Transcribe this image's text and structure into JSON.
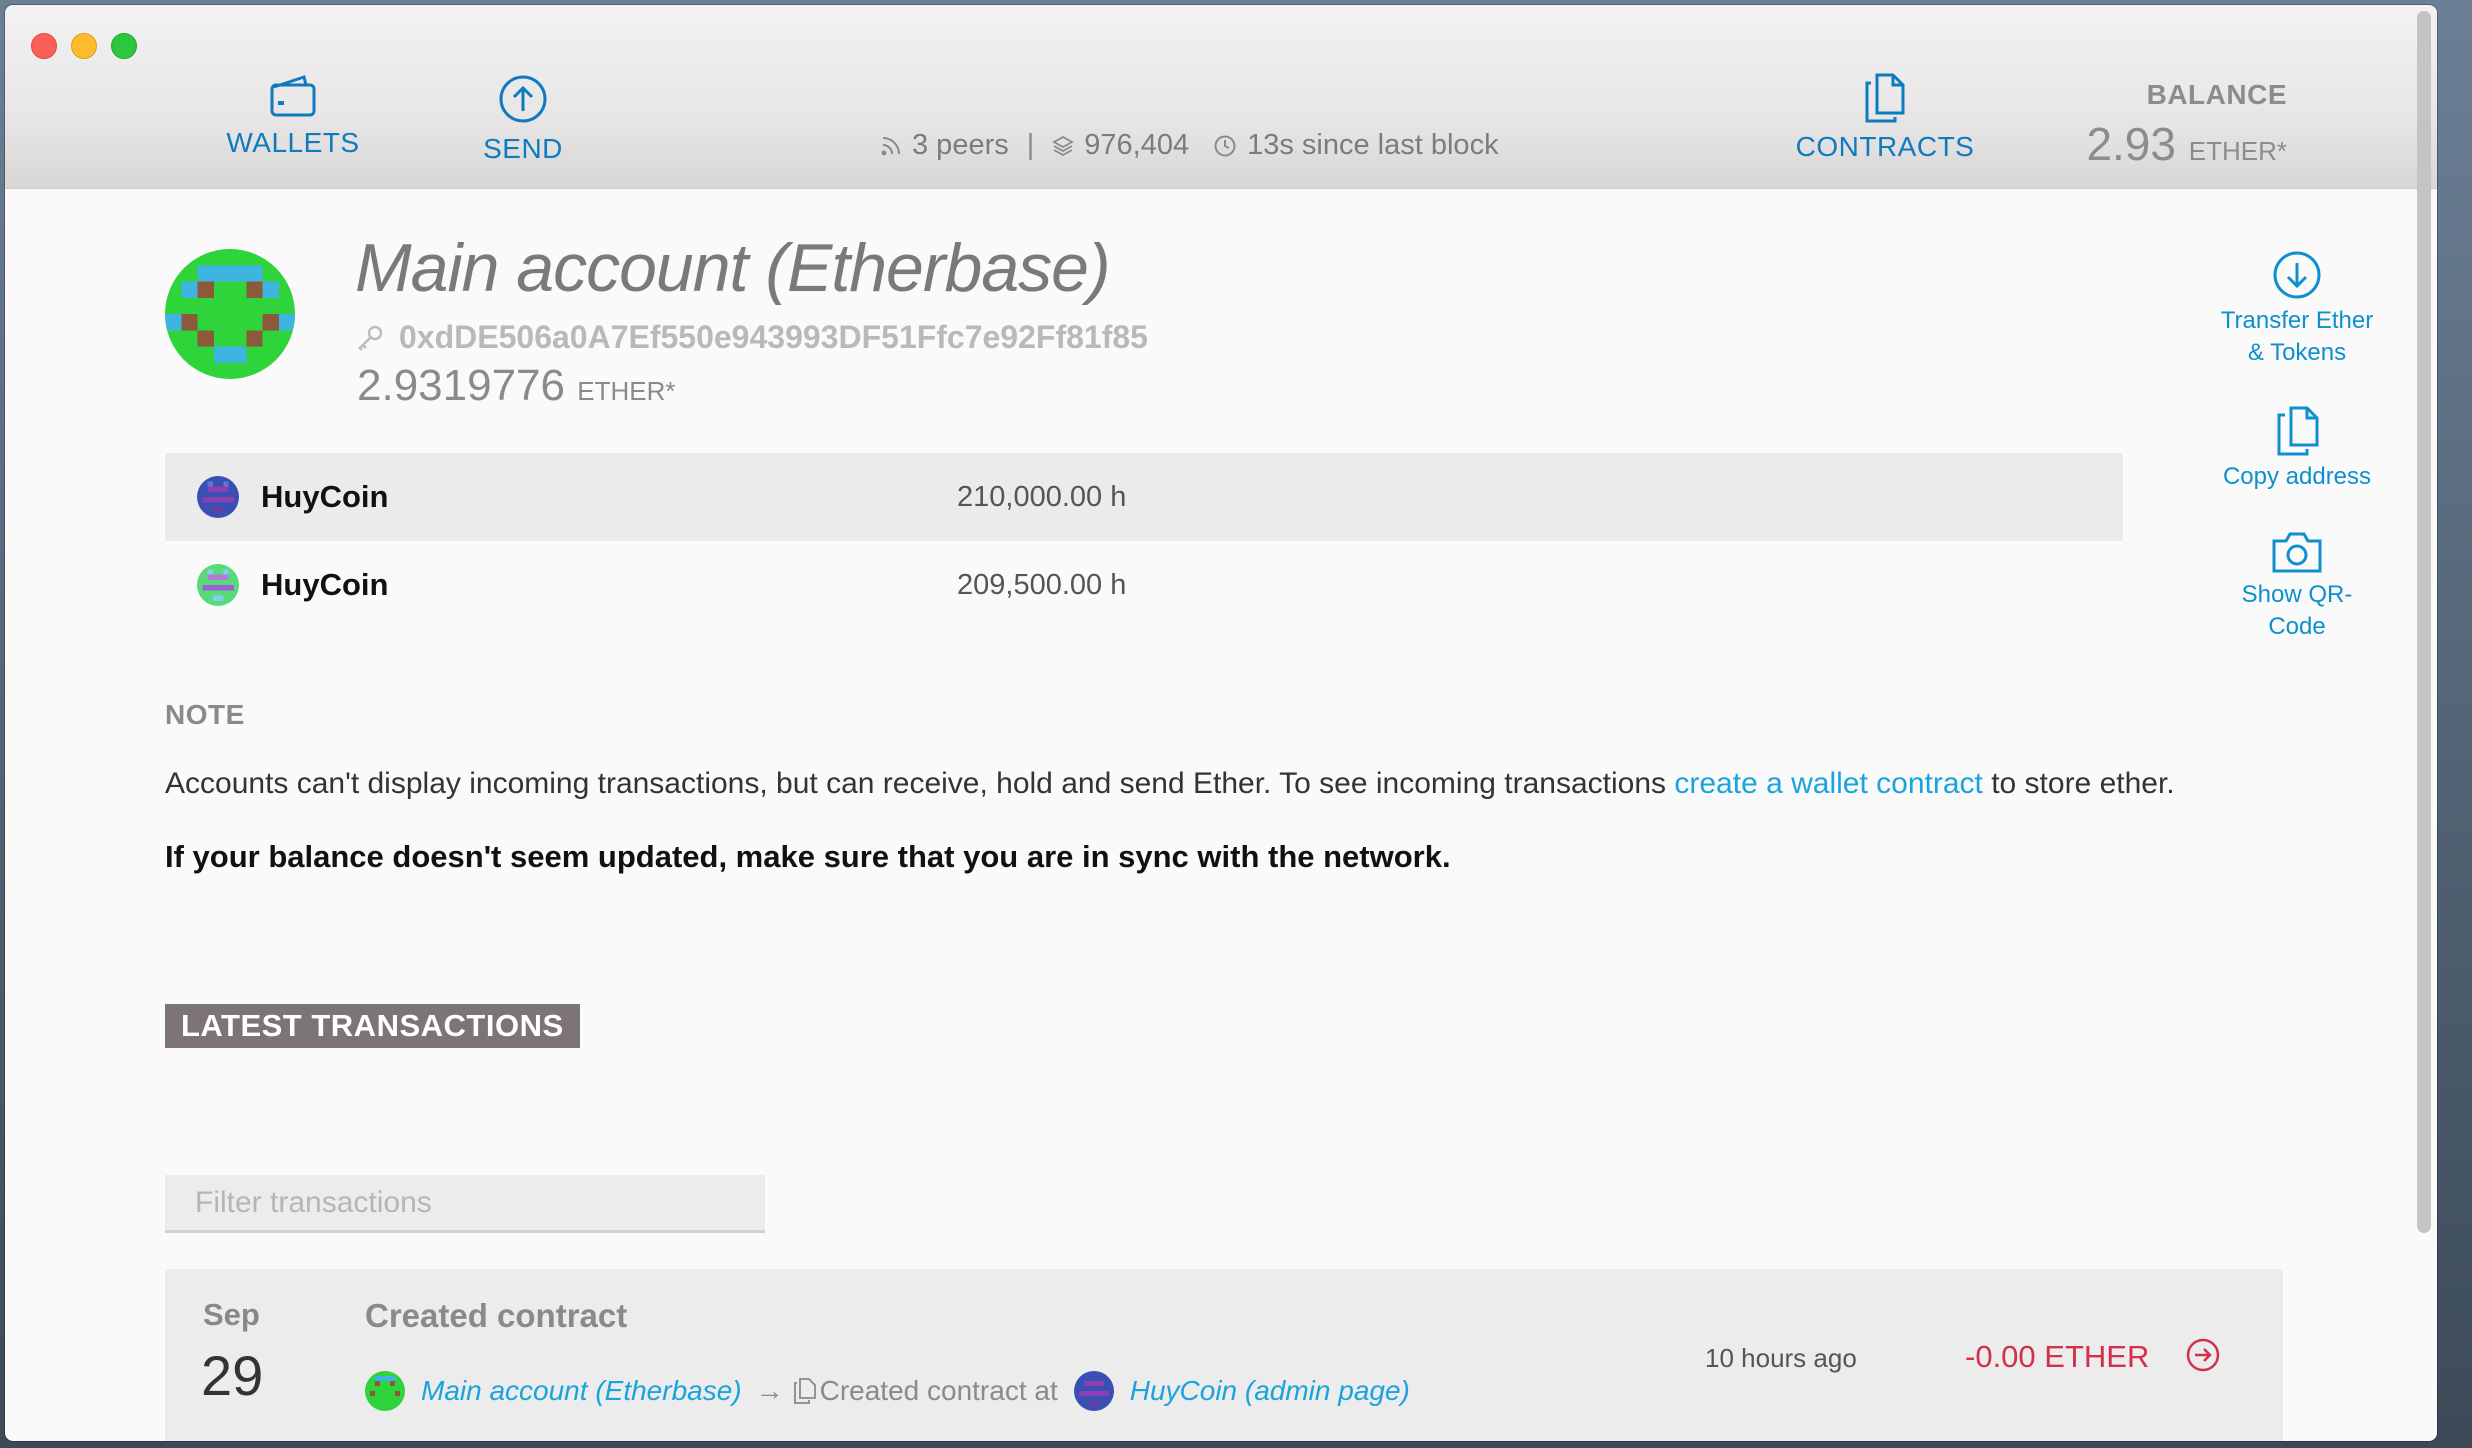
{
  "nav": {
    "wallets": "WALLETS",
    "send": "SEND",
    "contracts": "CONTRACTS"
  },
  "status": {
    "peers": "3 peers",
    "block": "976,404",
    "since": "13s since last block"
  },
  "balance": {
    "label": "BALANCE",
    "value": "2.93",
    "unit": "ETHER*"
  },
  "account": {
    "name": "Main account (Etherbase)",
    "address": "0xdDE506a0A7Ef550e943993DF51Ffc7e92Ff81f85",
    "balance": "2.9319776",
    "unit": "ETHER*"
  },
  "tokens": [
    {
      "name": "HuyCoin",
      "value": "210,000.00 h"
    },
    {
      "name": "HuyCoin",
      "value": "209,500.00 h"
    }
  ],
  "actions": {
    "transfer": "Transfer Ether & Tokens",
    "copy": "Copy address",
    "qr": "Show QR-Code"
  },
  "note": {
    "title": "NOTE",
    "text_before": "Accounts can't display incoming transactions, but can receive, hold and send Ether. To see incoming transactions ",
    "link": "create a wallet contract",
    "text_after": " to store ether.",
    "bold": "If your balance doesn't seem updated, make sure that you are in sync with the network."
  },
  "latest": {
    "title": "LATEST TRANSACTIONS",
    "filter_placeholder": "Filter transactions"
  },
  "transaction": {
    "month": "Sep",
    "day": "29",
    "type": "Created contract",
    "from": "Main account (Etherbase)",
    "arrow": "→",
    "action": "Created contract at",
    "to": "HuyCoin (admin page)",
    "time": "10 hours ago",
    "amount": "-0.00 ETHER"
  },
  "colors": {
    "accent": "#0f7bbf",
    "link": "#1aa3dd",
    "negative": "#d3304a"
  },
  "icons": {
    "wallets": "wallet-icon",
    "send": "arrow-up-circle-icon",
    "contracts": "document-icon",
    "peers": "signal-icon",
    "blocks": "layers-icon",
    "clock": "clock-icon",
    "key": "key-icon",
    "transfer": "arrow-down-circle-icon",
    "copy": "copy-icon",
    "qr": "camera-icon",
    "tx_go": "arrow-right-circle-icon"
  }
}
